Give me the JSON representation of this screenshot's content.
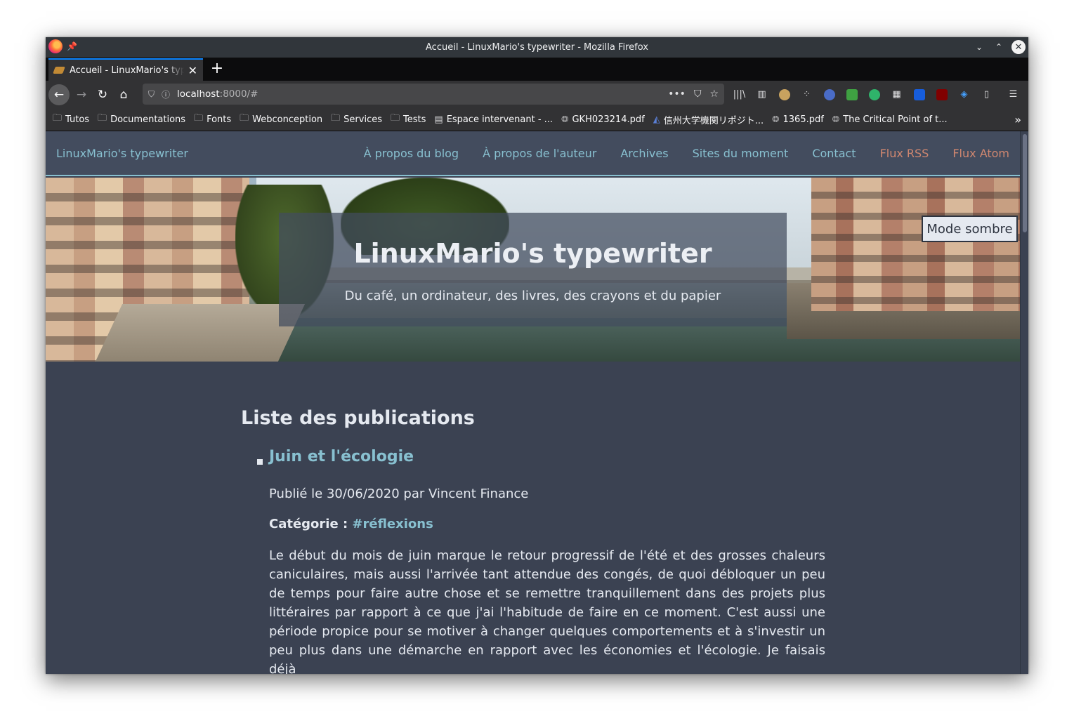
{
  "window": {
    "title": "Accueil - LinuxMario's typewriter - Mozilla Firefox"
  },
  "tab": {
    "label": "Accueil - LinuxMario's typewriter"
  },
  "urlbar": {
    "host": "localhost",
    "rest": ":8000/#"
  },
  "bookmarks": [
    {
      "label": "Tutos",
      "icon": "folder-icon"
    },
    {
      "label": "Documentations",
      "icon": "folder-icon"
    },
    {
      "label": "Fonts",
      "icon": "folder-icon"
    },
    {
      "label": "Webconception",
      "icon": "folder-icon"
    },
    {
      "label": "Services",
      "icon": "folder-icon"
    },
    {
      "label": "Tests",
      "icon": "folder-icon"
    },
    {
      "label": "Espace intervenant - ...",
      "icon": "page-icon"
    },
    {
      "label": "GKH023214.pdf",
      "icon": "globe-icon"
    },
    {
      "label": "信州大学機関リポジト...",
      "icon": "repository-icon"
    },
    {
      "label": "1365.pdf",
      "icon": "globe-icon"
    },
    {
      "label": "The Critical Point of t...",
      "icon": "globe-icon"
    }
  ],
  "site": {
    "brand": "LinuxMario's typewriter",
    "nav": [
      {
        "label": "À propos du blog"
      },
      {
        "label": "À propos de l'auteur"
      },
      {
        "label": "Archives"
      },
      {
        "label": "Sites du moment"
      },
      {
        "label": "Contact"
      },
      {
        "label": "Flux RSS"
      },
      {
        "label": "Flux Atom"
      }
    ],
    "hero_title": "LinuxMario's typewriter",
    "hero_subtitle": "Du café, un ordinateur, des livres, des crayons et du papier",
    "dark_mode_button": "Mode sombre"
  },
  "content": {
    "heading": "Liste des publications",
    "post": {
      "title": "Juin et l'écologie",
      "meta": "Publié le 30/06/2020 par Vincent Finance",
      "category_label": "Catégorie : ",
      "category_tag": "#réflexions",
      "excerpt": "Le début du mois de juin marque le retour progressif de l'été et des grosses chaleurs caniculaires, mais aussi l'arrivée tant attendue des congés, de quoi débloquer un peu de temps pour faire autre chose et se remettre tranquillement dans des projets plus littéraires par rapport à ce que j'ai l'habitude de faire en ce moment. C'est aussi une période propice pour se motiver à changer quelques comportements et à s'investir un peu plus dans une démarche en rapport avec les économies et l'écologie. Je faisais déjà"
    }
  },
  "colors": {
    "page_bg": "#3b4252",
    "nav_bg": "#434c5e",
    "accent": "#88c0d0",
    "feed_link": "#d08770",
    "text": "#e5e9f0"
  }
}
